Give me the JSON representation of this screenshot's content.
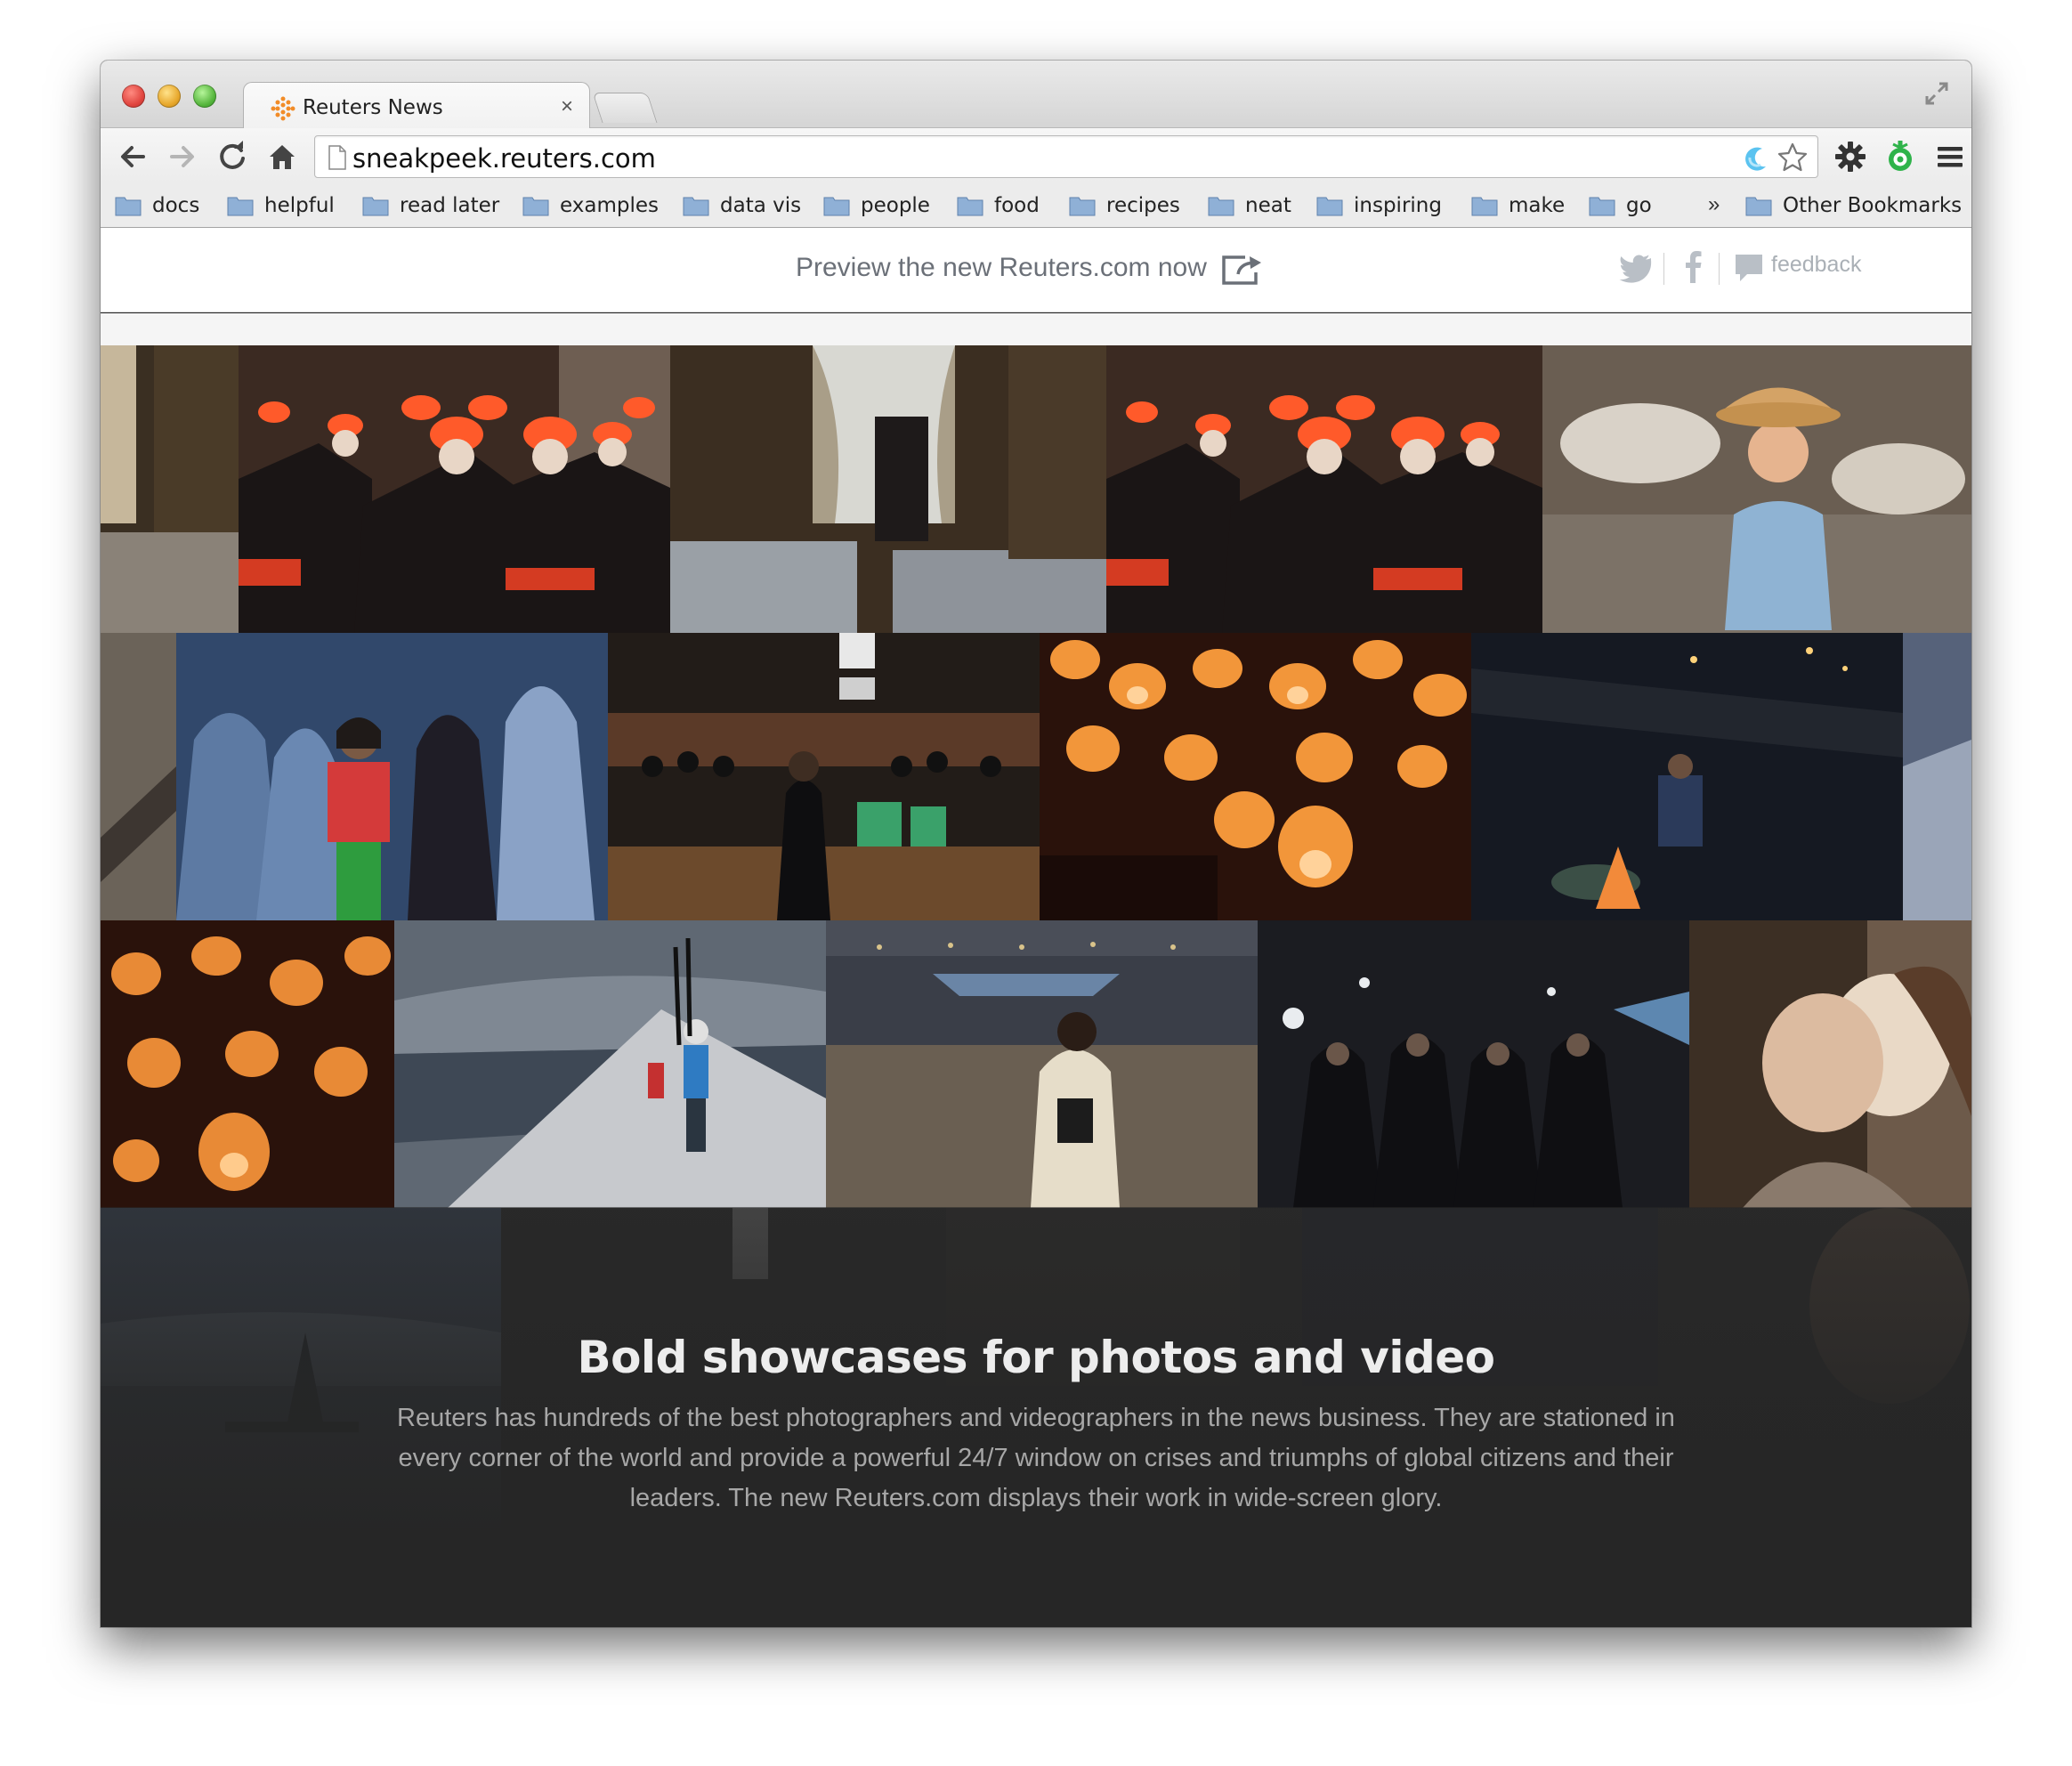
{
  "browser": {
    "tab_title": "Reuters News",
    "tab_close": "×",
    "url": "sneakpeek.reuters.com",
    "bookmarks": [
      "docs",
      "helpful",
      "read later",
      "examples",
      "data vis",
      "people",
      "food",
      "recipes",
      "neat",
      "inspiring",
      "make",
      "go"
    ],
    "bookmarks_overflow": "»",
    "other_bookmarks": "Other Bookmarks",
    "icons": {
      "back": "back-arrow-icon",
      "forward": "forward-arrow-icon",
      "reload": "reload-icon",
      "home": "home-icon",
      "star": "star-icon",
      "settings": "gear-icon",
      "menu": "hamburger-icon",
      "extension": "extension-icon",
      "fullscreen": "fullscreen-icon"
    }
  },
  "page": {
    "preview_link": "Preview the new Reuters.com now",
    "feedback": "feedback",
    "headline": "Bold showcases for photos and video",
    "body": "Reuters has hundreds of the best photographers and videographers in the news business. They are stationed in every corner of the world and provide a powerful 24/7 window on crises and triumphs of global citizens and their leaders. The new Reuters.com displays their work in wide-screen glory."
  },
  "colors": {
    "page_bg": "#262626",
    "preview_text": "#6b7078",
    "headline": "#ededed",
    "body_text": "#a7a7a7",
    "reuters_orange": "#f28c28"
  }
}
